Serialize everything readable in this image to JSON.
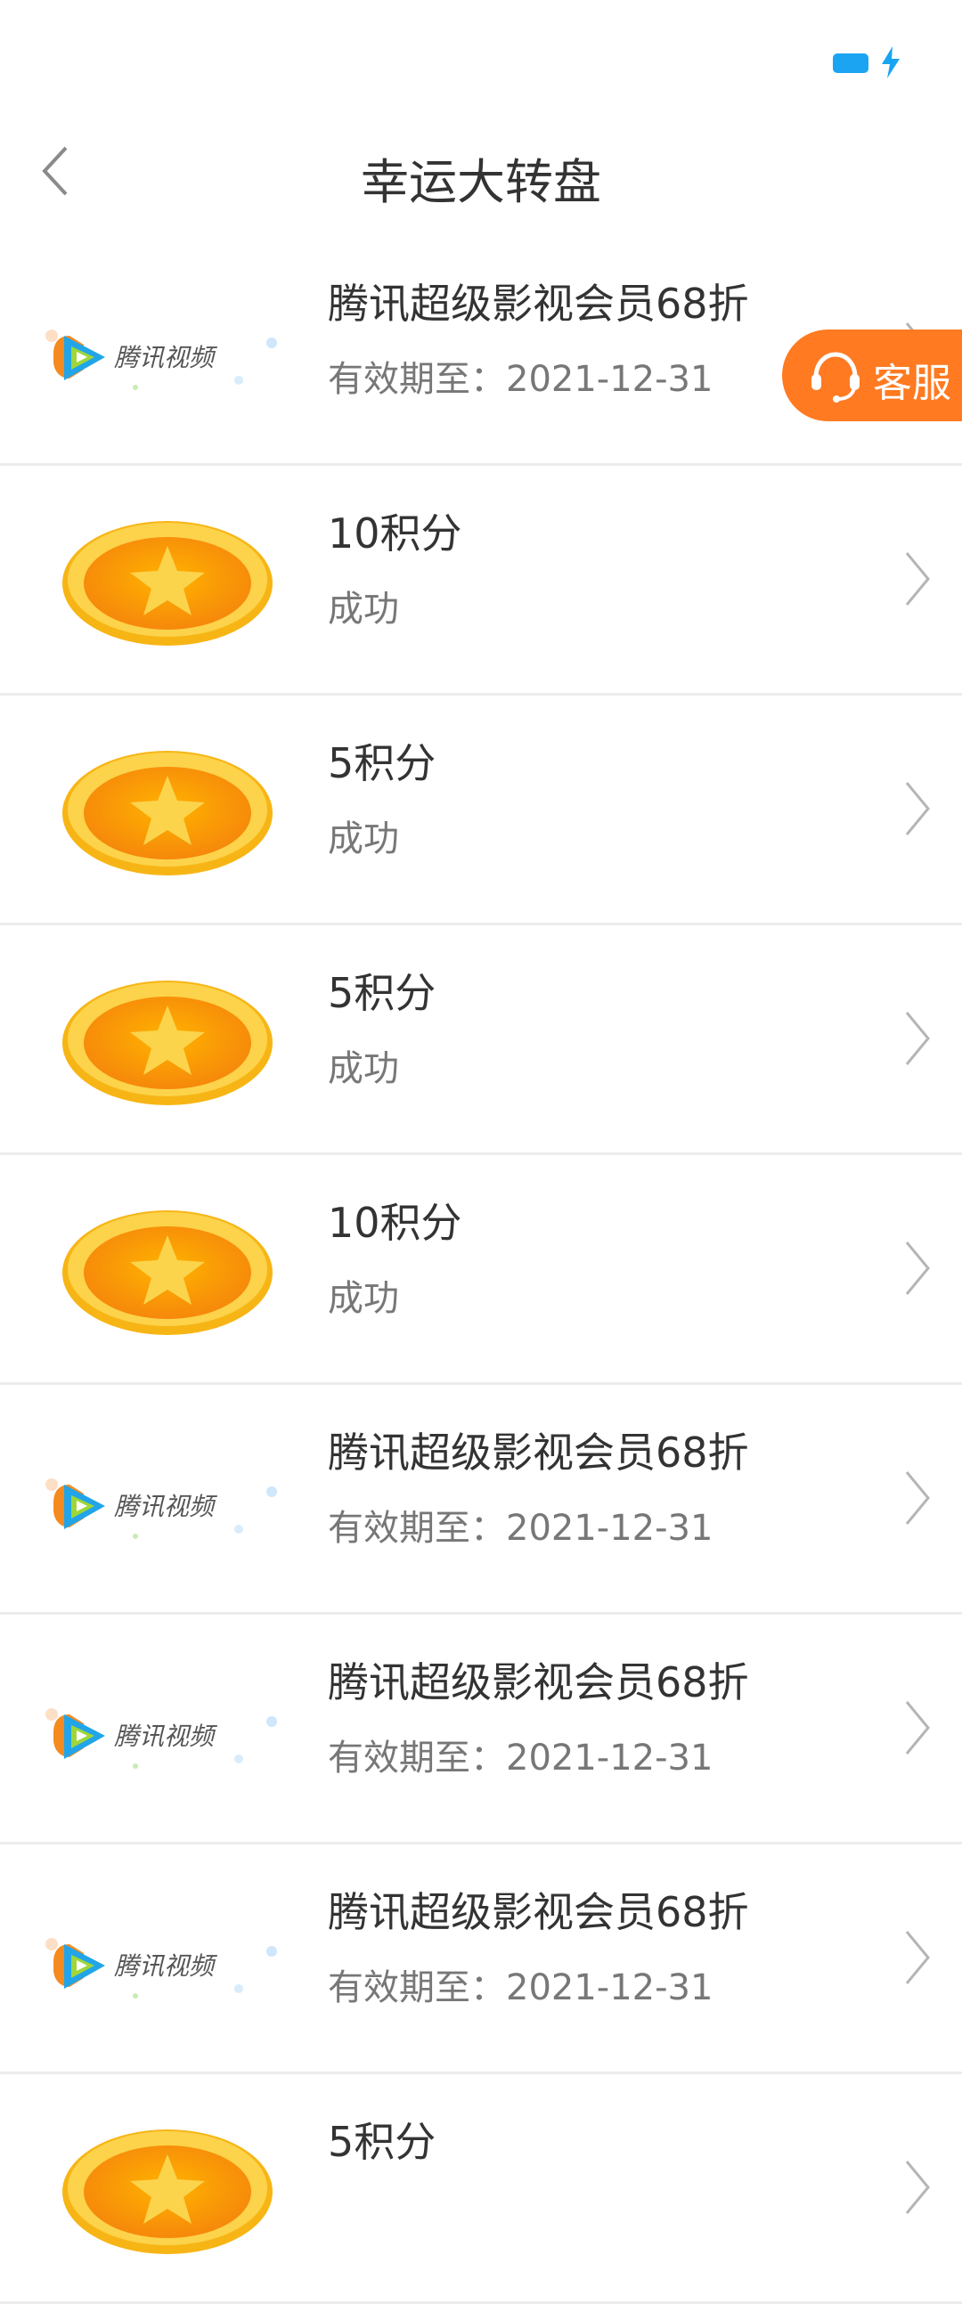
{
  "header": {
    "title": "幸运大转盘"
  },
  "service_button": {
    "label": "客服"
  },
  "colors": {
    "accent": "#ff7a21",
    "battery": "#1aa4f2"
  },
  "items": [
    {
      "type": "tencent",
      "title": "腾讯超级影视会员68折",
      "subtitle": "有效期至：2021-12-31",
      "logo_text": "腾讯视频"
    },
    {
      "type": "coin",
      "title": "10积分",
      "subtitle": "成功"
    },
    {
      "type": "coin",
      "title": "5积分",
      "subtitle": "成功"
    },
    {
      "type": "coin",
      "title": "5积分",
      "subtitle": "成功"
    },
    {
      "type": "coin",
      "title": "10积分",
      "subtitle": "成功"
    },
    {
      "type": "tencent",
      "title": "腾讯超级影视会员68折",
      "subtitle": "有效期至：2021-12-31",
      "logo_text": "腾讯视频"
    },
    {
      "type": "tencent",
      "title": "腾讯超级影视会员68折",
      "subtitle": "有效期至：2021-12-31",
      "logo_text": "腾讯视频"
    },
    {
      "type": "tencent",
      "title": "腾讯超级影视会员68折",
      "subtitle": "有效期至：2021-12-31",
      "logo_text": "腾讯视频"
    },
    {
      "type": "coin",
      "title": "5积分",
      "subtitle": ""
    }
  ]
}
